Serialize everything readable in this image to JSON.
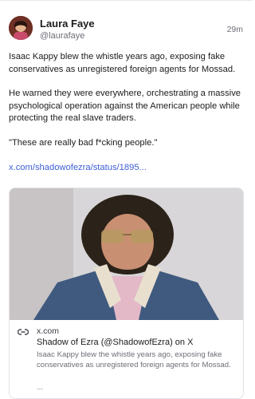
{
  "author": {
    "name": "Laura Faye",
    "handle": "@laurafaye"
  },
  "timestamp": "29m",
  "post": {
    "paragraphs": [
      "Isaac Kappy blew the whistle years ago, exposing fake conservatives as unregistered foreign agents for Mossad.",
      "He warned they were everywhere, orchestrating a massive psychological operation against the American people while protecting the real slave traders.",
      "\"These are really bad f*cking people.\""
    ],
    "link_text": "x.com/shadowofezra/status/1895..."
  },
  "card": {
    "domain": "x.com",
    "title": "Shadow of Ezra (@ShadowofEzra) on X",
    "description": "Isaac Kappy blew the whistle years ago, exposing fake conservatives as unregistered foreign agents for Mossad.",
    "ellipsis": "...",
    "icon": "link-icon"
  }
}
